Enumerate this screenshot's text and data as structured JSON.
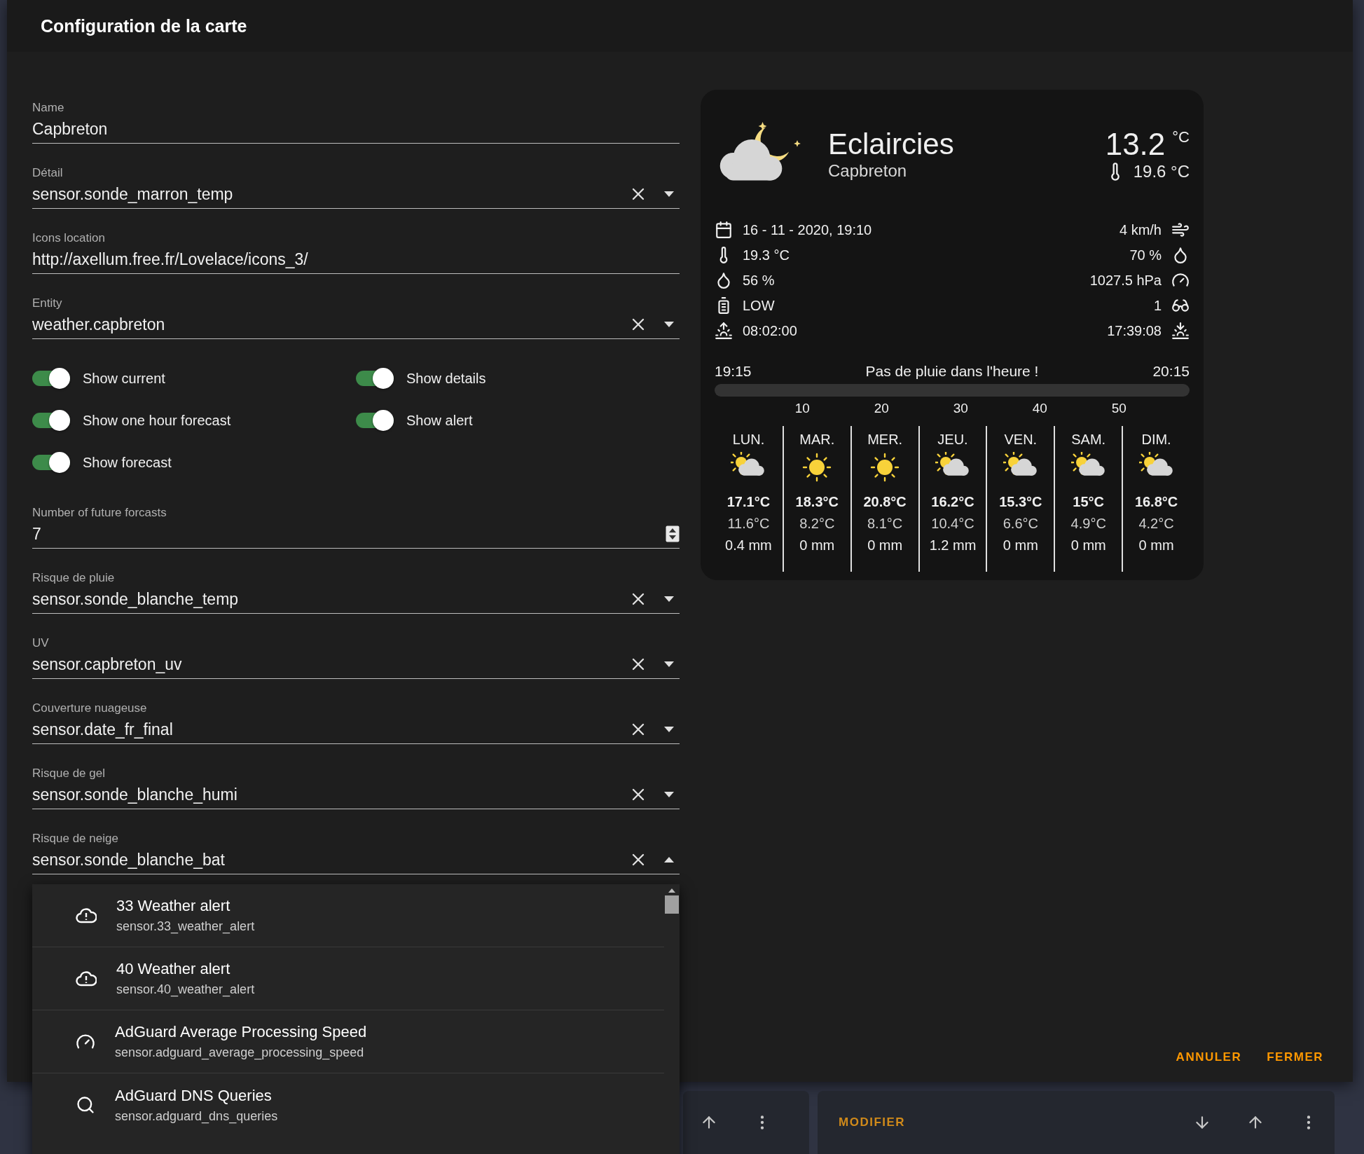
{
  "dialog": {
    "title": "Configuration de la carte",
    "fields": [
      {
        "kind": "text",
        "label": "Name",
        "value": "Capbreton"
      },
      {
        "kind": "entity",
        "label": "Détail",
        "value": "sensor.sonde_marron_temp",
        "expanded": false
      },
      {
        "kind": "text",
        "label": "Icons location",
        "value": "http://axellum.free.fr/Lovelace/icons_3/"
      },
      {
        "kind": "entity",
        "label": "Entity",
        "value": "weather.capbreton",
        "expanded": false
      }
    ],
    "toggles": [
      {
        "label": "Show current",
        "on": true
      },
      {
        "label": "Show details",
        "on": true
      },
      {
        "label": "Show one hour forecast",
        "on": true
      },
      {
        "label": "Show alert",
        "on": true
      },
      {
        "label": "Show forecast",
        "on": true
      }
    ],
    "fields_2": [
      {
        "kind": "number",
        "label": "Number of future forcasts",
        "value": "7"
      },
      {
        "kind": "entity",
        "label": "Risque de pluie",
        "value": "sensor.sonde_blanche_temp",
        "expanded": false
      },
      {
        "kind": "entity",
        "label": "UV",
        "value": "sensor.capbreton_uv",
        "expanded": false
      },
      {
        "kind": "entity",
        "label": "Couverture nuageuse",
        "value": "sensor.date_fr_final",
        "expanded": false
      },
      {
        "kind": "entity",
        "label": "Risque de gel",
        "value": "sensor.sonde_blanche_humi",
        "expanded": false
      },
      {
        "kind": "entity",
        "label": "Risque de neige",
        "value": "sensor.sonde_blanche_bat",
        "expanded": true
      }
    ],
    "actions": [
      "ANNULER",
      "FERMER"
    ]
  },
  "preview": {
    "condition": "Eclaircies",
    "location": "Capbreton",
    "temperature": "13.2",
    "unit": "°C",
    "feels_like": "19.6 °C",
    "details_left": [
      {
        "kind": "date",
        "text": "16 - 11 - 2020, 19:10"
      },
      {
        "kind": "temperature",
        "text": "19.3 °C"
      },
      {
        "kind": "humidity",
        "text": "56 %"
      },
      {
        "kind": "battery",
        "text": "LOW"
      },
      {
        "kind": "sunrise",
        "text": "08:02:00"
      }
    ],
    "details_right": [
      {
        "kind": "wind",
        "text": "4 km/h"
      },
      {
        "kind": "humidity",
        "text": "70 %"
      },
      {
        "kind": "pressure",
        "text": "1027.5 hPa"
      },
      {
        "kind": "uv",
        "text": "1"
      },
      {
        "kind": "sunset",
        "text": "17:39:08"
      }
    ],
    "rain": {
      "start": "19:15",
      "message": "Pas de pluie dans l'heure !",
      "end": "20:15",
      "ticks": [
        "10",
        "20",
        "30",
        "40",
        "50"
      ]
    },
    "forecast": [
      {
        "day": "LUN.",
        "kind": "partly-cloudy",
        "high": "17.1°C",
        "low": "11.6°C",
        "precipitation": "0.4 mm"
      },
      {
        "day": "MAR.",
        "kind": "sunny",
        "high": "18.3°C",
        "low": "8.2°C",
        "precipitation": "0 mm"
      },
      {
        "day": "MER.",
        "kind": "sunny",
        "high": "20.8°C",
        "low": "8.1°C",
        "precipitation": "0 mm"
      },
      {
        "day": "JEU.",
        "kind": "partly-cloudy",
        "high": "16.2°C",
        "low": "10.4°C",
        "precipitation": "1.2 mm"
      },
      {
        "day": "VEN.",
        "kind": "partly-cloudy",
        "high": "15.3°C",
        "low": "6.6°C",
        "precipitation": "0 mm"
      },
      {
        "day": "SAM.",
        "kind": "partly-cloudy",
        "high": "15°C",
        "low": "4.9°C",
        "precipitation": "0 mm"
      },
      {
        "day": "DIM.",
        "kind": "partly-cloudy",
        "high": "16.8°C",
        "low": "4.2°C",
        "precipitation": "0 mm"
      }
    ]
  },
  "dropdown": {
    "items": [
      {
        "kind": "alert",
        "name": "33 Weather alert",
        "entity_id": "sensor.33_weather_alert"
      },
      {
        "kind": "alert",
        "name": "40 Weather alert",
        "entity_id": "sensor.40_weather_alert"
      },
      {
        "kind": "speed",
        "name": "AdGuard Average Processing Speed",
        "entity_id": "sensor.adguard_average_processing_speed"
      },
      {
        "kind": "search",
        "name": "AdGuard DNS Queries",
        "entity_id": "sensor.adguard_dns_queries"
      }
    ]
  },
  "background": {
    "edit_button": "MODIFIER"
  }
}
